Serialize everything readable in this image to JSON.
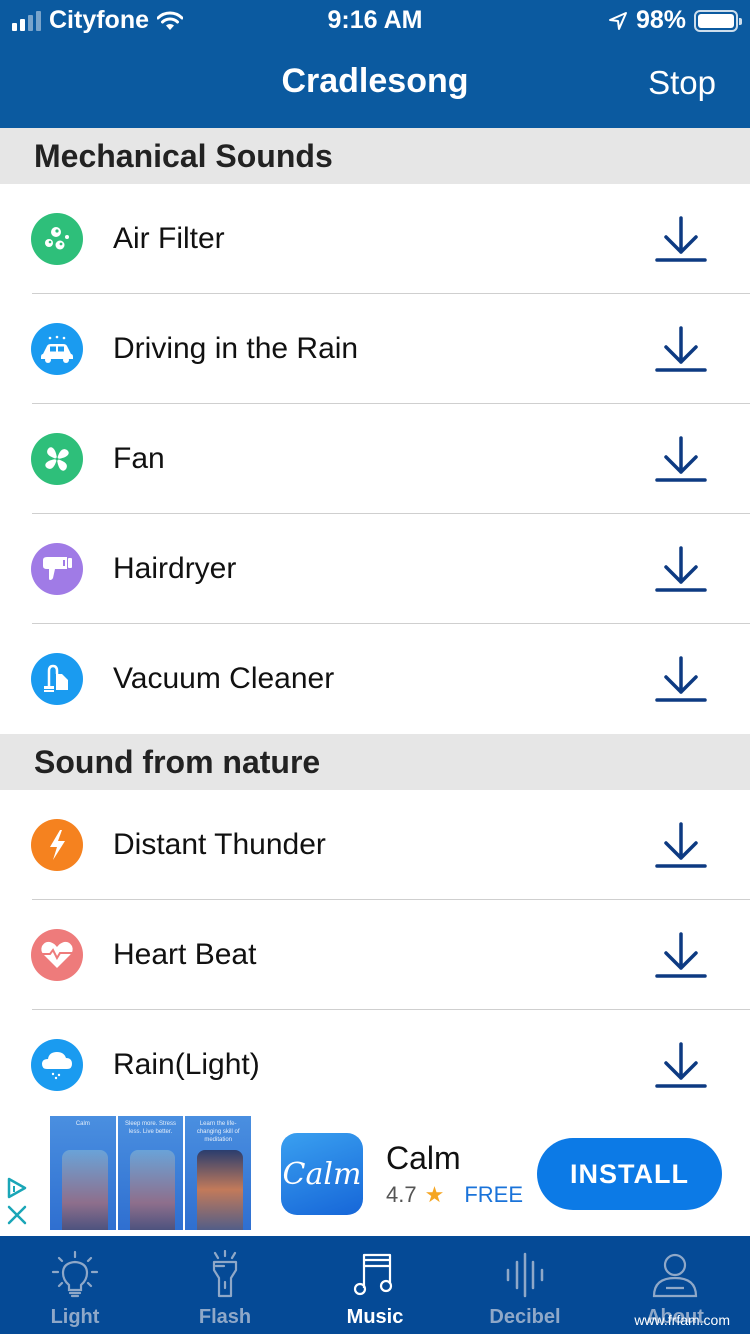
{
  "status_bar": {
    "carrier": "Cityfone",
    "time": "9:16 AM",
    "battery": "98%",
    "icons": [
      "signal-icon",
      "wifi-icon",
      "location-arrow-icon",
      "battery-icon"
    ]
  },
  "navbar": {
    "title": "Cradlesong",
    "stop_label": "Stop"
  },
  "sections": [
    {
      "title": "Mechanical Sounds",
      "items": [
        {
          "label": "Air Filter",
          "icon": "bubbles-icon",
          "color": "#2ebf7a"
        },
        {
          "label": "Driving in the Rain",
          "icon": "car-rain-icon",
          "color": "#1a9bf0"
        },
        {
          "label": "Fan",
          "icon": "fan-icon",
          "color": "#2ebf7a"
        },
        {
          "label": "Hairdryer",
          "icon": "hairdryer-icon",
          "color": "#a07be6"
        },
        {
          "label": "Vacuum Cleaner",
          "icon": "vacuum-icon",
          "color": "#1a9bf0"
        }
      ]
    },
    {
      "title": "Sound from nature",
      "items": [
        {
          "label": "Distant Thunder",
          "icon": "lightning-icon",
          "color": "#f5821f"
        },
        {
          "label": "Heart Beat",
          "icon": "heartbeat-icon",
          "color": "#ee7b7b"
        },
        {
          "label": "Rain(Light)",
          "icon": "rain-cloud-icon",
          "color": "#1a9bf0"
        }
      ]
    }
  ],
  "download_icon": "download-icon",
  "ad": {
    "app_name": "Calm",
    "app_icon_text": "Calm",
    "rating": "4.7",
    "price": "FREE",
    "install_label": "INSTALL",
    "screenshot_captions": [
      "Calm",
      "Sleep more. Stress less. Live better.",
      "Learn the life-changing skill of meditation"
    ]
  },
  "tabbar": {
    "tabs": [
      {
        "label": "Light",
        "icon": "lightbulb-icon",
        "active": false
      },
      {
        "label": "Flash",
        "icon": "flashlight-icon",
        "active": false
      },
      {
        "label": "Music",
        "icon": "music-note-icon",
        "active": true
      },
      {
        "label": "Decibel",
        "icon": "sound-wave-icon",
        "active": false
      },
      {
        "label": "About",
        "icon": "person-icon",
        "active": false
      }
    ]
  },
  "watermark": "www.frfam.com",
  "colors": {
    "header_bg": "#0b5aa0",
    "tabbar_bg": "#054a96",
    "download_icon": "#0d3a82",
    "install_button": "#0c7ae6"
  }
}
